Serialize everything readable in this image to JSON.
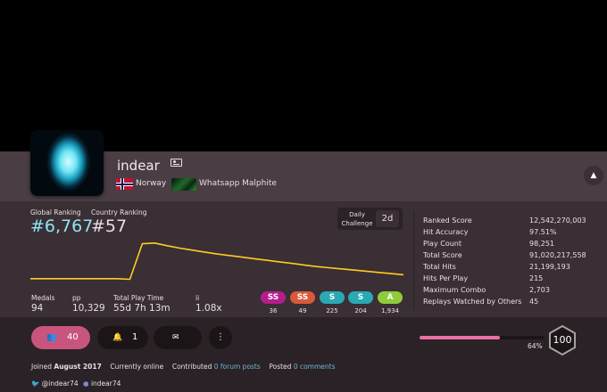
{
  "user": {
    "username": "indear",
    "country": "Norway",
    "team": "Whatsapp Malphite"
  },
  "rankings": {
    "global_label": "Global Ranking",
    "global_value": "#6,767",
    "country_label": "Country Ranking",
    "country_value": "#57",
    "daily_label": "Daily Challenge",
    "daily_value": "2d"
  },
  "stats": {
    "medals_label": "Medals",
    "medals_value": "94",
    "pp_label": "pp",
    "pp_value": "10,329",
    "playtime_label": "Total Play Time",
    "playtime_value": "55d 7h 13m",
    "ii_label": "ii",
    "ii_value": "1.08x"
  },
  "grades": [
    {
      "label": "SS",
      "count": "36",
      "color": "#b51d8b"
    },
    {
      "label": "SS",
      "count": "49",
      "color": "#d95a3a"
    },
    {
      "label": "S",
      "count": "225",
      "color": "#2aa9b5"
    },
    {
      "label": "S",
      "count": "204",
      "color": "#2aa9b5"
    },
    {
      "label": "A",
      "count": "1,934",
      "color": "#8fcc3a"
    }
  ],
  "ranked_stats": [
    {
      "label": "Ranked Score",
      "value": "12,542,270,003"
    },
    {
      "label": "Hit Accuracy",
      "value": "97.51%"
    },
    {
      "label": "Play Count",
      "value": "98,251"
    },
    {
      "label": "Total Score",
      "value": "91,020,217,558"
    },
    {
      "label": "Total Hits",
      "value": "21,199,193"
    },
    {
      "label": "Hits Per Play",
      "value": "215"
    },
    {
      "label": "Maximum Combo",
      "value": "2,703"
    },
    {
      "label": "Replays Watched by Others",
      "value": "45"
    }
  ],
  "actions": {
    "followers": "40",
    "notifications": "1"
  },
  "level": {
    "progress_percent": 64,
    "progress_label": "64%",
    "value": "100"
  },
  "footer": {
    "joined_prefix": "Joined",
    "joined_value": "August 2017",
    "online": "Currently online",
    "contributed_prefix": "Contributed",
    "forum_posts": "0 forum posts",
    "posted_prefix": "Posted",
    "comments": "0 comments",
    "twitter": "@indear74",
    "discord": "indear74"
  },
  "rank_history": {
    "type": "line",
    "values": [
      5,
      5,
      5,
      5,
      5,
      5,
      5,
      5,
      3.5,
      94,
      96,
      89,
      83,
      78,
      73,
      68,
      64,
      60,
      56,
      52,
      48,
      44,
      40,
      36,
      33,
      30,
      27,
      24,
      21,
      18,
      15
    ],
    "color": "#ffcc22"
  },
  "colors": {
    "accent_pink": "#c9557e",
    "rank_blue": "#8ee6f4",
    "link_blue": "#6fb7d6"
  }
}
